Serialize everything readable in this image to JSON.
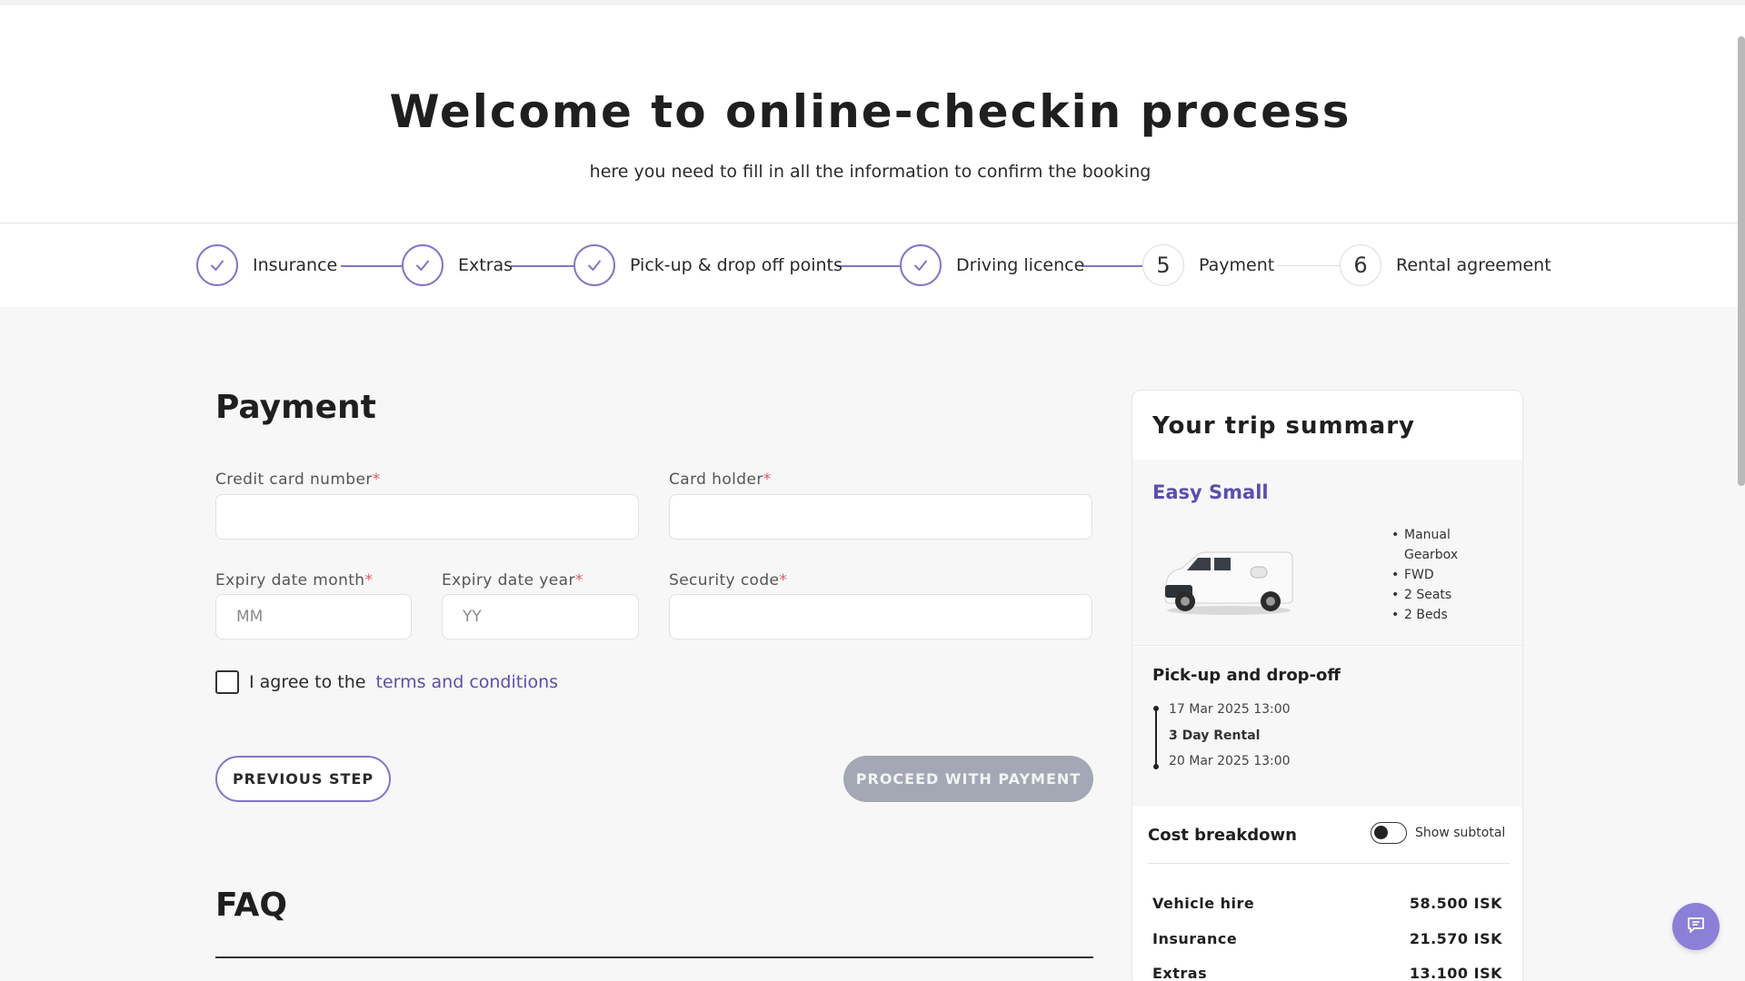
{
  "hero": {
    "title": "Welcome to online-checkin process",
    "subtitle": "here you need to fill in all the information to confirm the booking"
  },
  "steps": [
    {
      "label": "Insurance",
      "status": "done",
      "icon": "check-icon"
    },
    {
      "label": "Extras",
      "status": "done",
      "icon": "check-icon"
    },
    {
      "label": "Pick-up & drop off points",
      "status": "done",
      "icon": "check-icon"
    },
    {
      "label": "Driving licence",
      "status": "done",
      "icon": "check-icon"
    },
    {
      "label": "Payment",
      "status": "current",
      "number": "5"
    },
    {
      "label": "Rental agreement",
      "status": "pending",
      "number": "6"
    }
  ],
  "payment": {
    "title": "Payment",
    "required_mark": "*",
    "card_number": {
      "label": "Credit card number",
      "value": "",
      "placeholder": ""
    },
    "card_holder": {
      "label": "Card holder",
      "value": "",
      "placeholder": ""
    },
    "expiry_month": {
      "label": "Expiry date month",
      "value": "",
      "placeholder": "MM"
    },
    "expiry_year": {
      "label": "Expiry date year",
      "value": "",
      "placeholder": "YY"
    },
    "security_code": {
      "label": "Security code",
      "value": "",
      "placeholder": ""
    },
    "agree_text": "I agree to the",
    "terms_link": "terms and conditions",
    "agree_checked": false,
    "previous_button": "PREVIOUS STEP",
    "proceed_button": "PROCEED WITH PAYMENT"
  },
  "faq": {
    "title": "FAQ"
  },
  "summary": {
    "title": "Your trip summary",
    "car_name": "Easy Small",
    "features": [
      "Manual Gearbox",
      "FWD",
      "2 Seats",
      "2 Beds"
    ],
    "pickup_title": "Pick-up and drop-off",
    "pickup_datetime": "17 Mar 2025 13:00",
    "rental_length": "3 Day Rental",
    "dropoff_datetime": "20 Mar 2025 13:00",
    "cost_title": "Cost breakdown",
    "show_subtotal_label": "Show subtotal",
    "show_subtotal_on": false,
    "costs": [
      {
        "label": "Vehicle hire",
        "amount": "58.500 ISK"
      },
      {
        "label": "Insurance",
        "amount": "21.570 ISK"
      },
      {
        "label": "Extras",
        "amount": "13.100 ISK"
      }
    ]
  },
  "colors": {
    "accent": "#7f77c6",
    "link": "#5a4fae",
    "required": "#e05a6a",
    "disabled_button": "#a4a8b5",
    "chat_button": "#8c7fd8"
  },
  "icons": {
    "chat": "chat-bubble-icon"
  }
}
